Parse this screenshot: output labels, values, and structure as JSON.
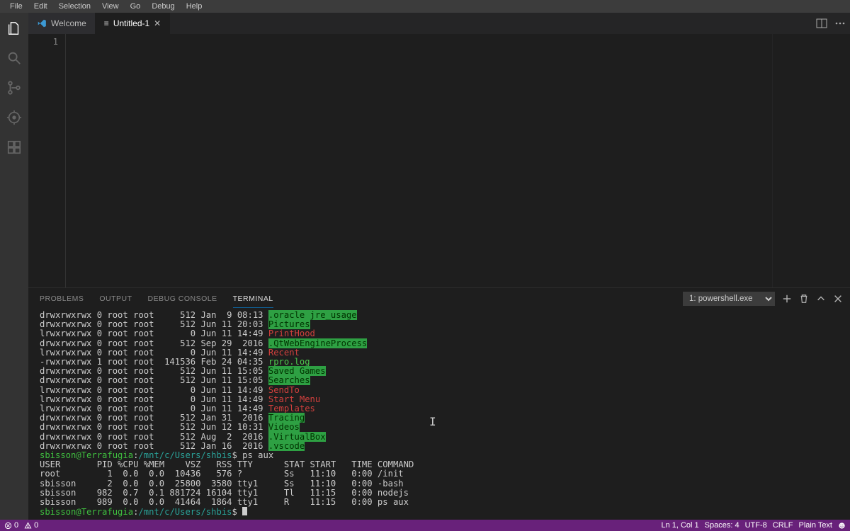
{
  "menubar": {
    "items": [
      "File",
      "Edit",
      "Selection",
      "View",
      "Go",
      "Debug",
      "Help"
    ]
  },
  "activitybar": {
    "icons": [
      "files-icon",
      "search-icon",
      "source-control-icon",
      "debug-icon",
      "extensions-icon"
    ]
  },
  "tabs": [
    {
      "label": "Welcome",
      "icon": "vs-logo",
      "active": false
    },
    {
      "label": "Untitled-1",
      "icon": "file-lines",
      "active": true
    }
  ],
  "editor": {
    "gutter_line": "1"
  },
  "panel": {
    "tabs": [
      "PROBLEMS",
      "OUTPUT",
      "DEBUG CONSOLE",
      "TERMINAL"
    ],
    "active_tab": "TERMINAL",
    "terminal_select": "1: powershell.exe",
    "actions": [
      "new-terminal-icon",
      "kill-terminal-icon",
      "chevron-up-icon",
      "close-icon"
    ]
  },
  "terminal": {
    "listing": [
      {
        "perms": "drwxrwxrwx 0 root root",
        "size": "512",
        "date": "Jan  9 08:13",
        "name": ".oracle_jre_usage",
        "style": "green-bg"
      },
      {
        "perms": "drwxrwxrwx 0 root root",
        "size": "512",
        "date": "Jun 11 20:03",
        "name": "Pictures",
        "style": "green-bg"
      },
      {
        "perms": "lrwxrwxrwx 0 root root",
        "size": "0",
        "date": "Jun 11 14:49",
        "name": "PrintHood",
        "style": "red"
      },
      {
        "perms": "drwxrwxrwx 0 root root",
        "size": "512",
        "date": "Sep 29  2016",
        "name": ".QtWebEngineProcess",
        "style": "green-bg"
      },
      {
        "perms": "lrwxrwxrwx 0 root root",
        "size": "0",
        "date": "Jun 11 14:49",
        "name": "Recent",
        "style": "red"
      },
      {
        "perms": "-rwxrwxrwx 1 root root",
        "size": "141536",
        "date": "Feb 24 04:35",
        "name": "rpro.log",
        "style": "grn"
      },
      {
        "perms": "drwxrwxrwx 0 root root",
        "size": "512",
        "date": "Jun 11 15:05",
        "name": "Saved Games",
        "style": "green-bg"
      },
      {
        "perms": "drwxrwxrwx 0 root root",
        "size": "512",
        "date": "Jun 11 15:05",
        "name": "Searches",
        "style": "green-bg"
      },
      {
        "perms": "lrwxrwxrwx 0 root root",
        "size": "0",
        "date": "Jun 11 14:49",
        "name": "SendTo",
        "style": "red"
      },
      {
        "perms": "lrwxrwxrwx 0 root root",
        "size": "0",
        "date": "Jun 11 14:49",
        "name": "Start Menu",
        "style": "red"
      },
      {
        "perms": "lrwxrwxrwx 0 root root",
        "size": "0",
        "date": "Jun 11 14:49",
        "name": "Templates",
        "style": "red"
      },
      {
        "perms": "drwxrwxrwx 0 root root",
        "size": "512",
        "date": "Jan 31  2016",
        "name": "Tracing",
        "style": "green-bg"
      },
      {
        "perms": "drwxrwxrwx 0 root root",
        "size": "512",
        "date": "Jun 12 10:31",
        "name": "Videos",
        "style": "green-bg"
      },
      {
        "perms": "drwxrwxrwx 0 root root",
        "size": "512",
        "date": "Aug  2  2016",
        "name": ".VirtualBox",
        "style": "green-bg"
      },
      {
        "perms": "drwxrwxrwx 0 root root",
        "size": "512",
        "date": "Jan 16  2016",
        "name": ".vscode",
        "style": "green-bg"
      }
    ],
    "prompt": {
      "user_host": "sbisson@Terrafugia",
      "colon": ":",
      "path": "/mnt/c/Users/shbis",
      "dollar": "$",
      "command1": "ps aux"
    },
    "ps_header": "USER       PID %CPU %MEM    VSZ   RSS TTY      STAT START   TIME COMMAND",
    "ps_rows": [
      "root         1  0.0  0.0  10436   576 ?        Ss   11:10   0:00 /init",
      "sbisson      2  0.0  0.0  25800  3580 tty1     Ss   11:10   0:00 -bash",
      "sbisson    982  0.7  0.1 881724 16104 tty1     Tl   11:15   0:00 nodejs",
      "sbisson    989  0.0  0.0  41464  1864 tty1     R    11:15   0:00 ps aux"
    ]
  },
  "statusbar": {
    "errors": "0",
    "warnings": "0",
    "line_col": "Ln 1, Col 1",
    "spaces": "Spaces: 4",
    "encoding": "UTF-8",
    "eol": "CRLF",
    "language": "Plain Text"
  }
}
